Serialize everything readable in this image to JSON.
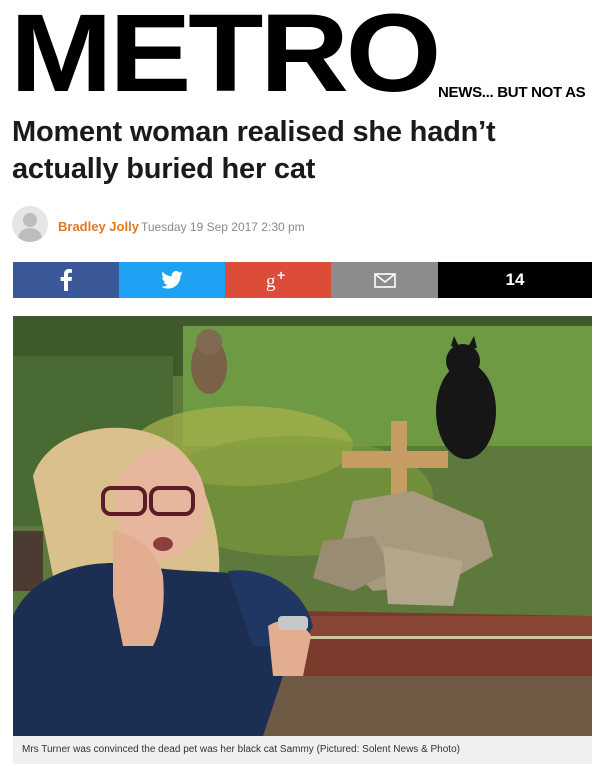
{
  "masthead": {
    "logo": "METRO",
    "tagline": "NEWS... BUT NOT AS"
  },
  "article": {
    "headline": "Moment woman realised she hadn’t actually buried her cat",
    "author": "Bradley Jolly",
    "date": "Tuesday 19 Sep 2017 2:30 pm"
  },
  "share": {
    "facebook_icon": "facebook-icon",
    "twitter_icon": "twitter-icon",
    "googleplus_icon": "google-plus-icon",
    "email_icon": "email-icon",
    "count": "14",
    "colors": {
      "facebook": "#3b5998",
      "twitter": "#1da1f2",
      "googleplus": "#dd4b39",
      "email": "#8c8c8c",
      "count": "#000000"
    }
  },
  "image": {
    "caption": "Mrs Turner was convinced the dead pet was her black cat Sammy (Pictured: Solent News & Photo)"
  }
}
